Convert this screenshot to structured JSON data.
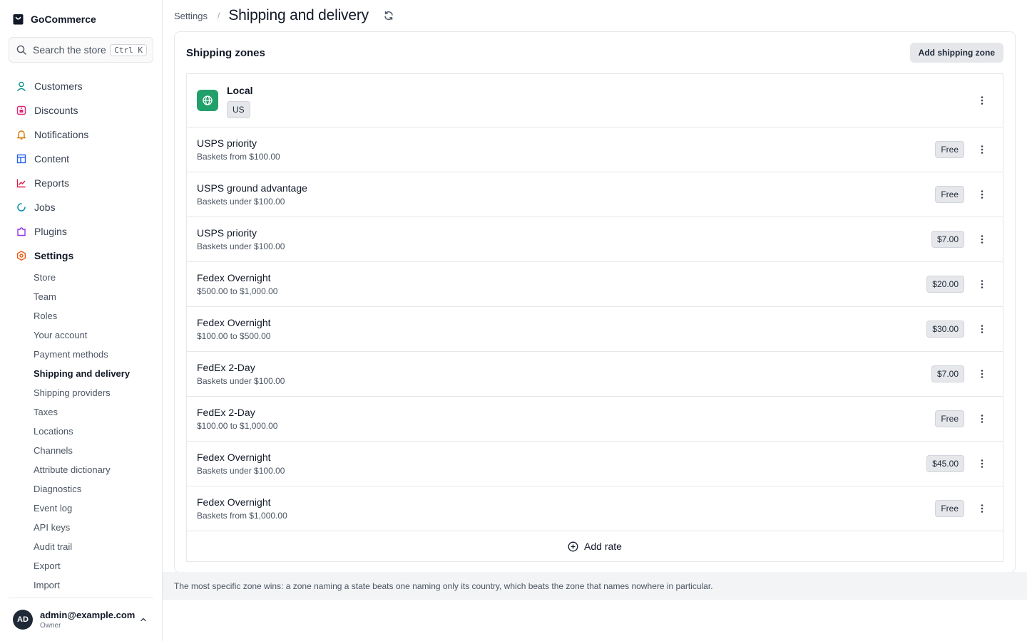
{
  "app": {
    "name": "GoCommerce"
  },
  "search": {
    "placeholder": "Search the store",
    "shortcut": "Ctrl K"
  },
  "nav": [
    {
      "label": "Customers",
      "icon": "user-icon",
      "color": "#0d9488"
    },
    {
      "label": "Discounts",
      "icon": "tag-icon",
      "color": "#db2777"
    },
    {
      "label": "Notifications",
      "icon": "bell-icon",
      "color": "#d97706"
    },
    {
      "label": "Content",
      "icon": "layout-icon",
      "color": "#2563eb"
    },
    {
      "label": "Reports",
      "icon": "chart-icon",
      "color": "#e11d48"
    },
    {
      "label": "Jobs",
      "icon": "loader-icon",
      "color": "#0891b2"
    },
    {
      "label": "Plugins",
      "icon": "puzzle-icon",
      "color": "#9333ea"
    },
    {
      "label": "Settings",
      "icon": "gear-icon",
      "color": "#ea580c"
    }
  ],
  "settings_menu": [
    "Store",
    "Team",
    "Roles",
    "Your account",
    "Payment methods",
    "Shipping and delivery",
    "Shipping providers",
    "Taxes",
    "Locations",
    "Channels",
    "Attribute dictionary",
    "Diagnostics",
    "Event log",
    "API keys",
    "Audit trail",
    "Export",
    "Import"
  ],
  "user": {
    "initials": "AD",
    "email": "admin@example.com",
    "role": "Owner"
  },
  "header": {
    "breadcrumb": "Settings",
    "separator": "/",
    "title": "Shipping and delivery"
  },
  "card": {
    "title": "Shipping zones",
    "add_zone_label": "Add shipping zone"
  },
  "zone": {
    "name": "Local",
    "tag": "US",
    "badge_color": "#22a06b",
    "rates": [
      {
        "name": "USPS priority",
        "condition": "Baskets from $100.00",
        "price": "Free"
      },
      {
        "name": "USPS ground advantage",
        "condition": "Baskets under $100.00",
        "price": "Free"
      },
      {
        "name": "USPS priority",
        "condition": "Baskets under $100.00",
        "price": "$7.00"
      },
      {
        "name": "Fedex Overnight",
        "condition": "$500.00 to $1,000.00",
        "price": "$20.00"
      },
      {
        "name": "Fedex Overnight",
        "condition": "$100.00 to $500.00",
        "price": "$30.00"
      },
      {
        "name": "FedEx 2-Day",
        "condition": "Baskets under $100.00",
        "price": "$7.00"
      },
      {
        "name": "FedEx 2-Day",
        "condition": "$100.00 to $1,000.00",
        "price": "Free"
      },
      {
        "name": "Fedex Overnight",
        "condition": "Baskets under $100.00",
        "price": "$45.00"
      },
      {
        "name": "Fedex Overnight",
        "condition": "Baskets from $1,000.00",
        "price": "Free"
      }
    ],
    "add_rate_label": "Add rate"
  },
  "footer_note": "The most specific zone wins: a zone naming a state beats one naming only its country, which beats the zone that names nowhere in particular."
}
